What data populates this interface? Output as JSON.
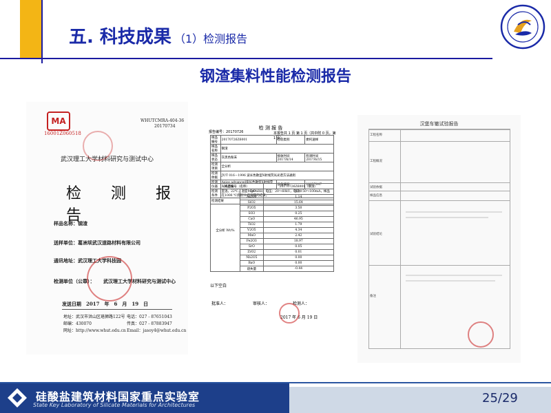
{
  "header": {
    "title": "五. 科技成果",
    "subtitle": "（1）检测报告",
    "colors": {
      "accent_yellow": "#f3b515",
      "primary_blue": "#1a2aa8",
      "line_blue": "#1a1aa0"
    }
  },
  "heading": "钢渣集料性能检测报告",
  "doc1": {
    "ma_mark": "MA",
    "ma_code": "16001Z060518",
    "ref_code": "WHUTCMRA-404-36",
    "ref_no": "20170734",
    "institution": "武汉理工大学材料研究与测试中心",
    "big_title": "检 测 报 告",
    "sample_label": "样品名称：钢渣",
    "client_label": "送样单位：葛洲坝武汉道路材料有限公司",
    "address_label": "通讯地址：武汉理工大学科技园",
    "test_unit_label": "检测单位（公章）：",
    "test_unit_value": "武汉理工大学材料研究与测试中心",
    "issue_date": "发送日期　2017　年　6　月　19　日",
    "contact_addr": "地址：武汉市洪山区珞狮路122号",
    "contact_post": "邮编：430070",
    "contact_web": "网址：http://www.whut.edu.cn",
    "contact_tel": "电话：027 - 87651043",
    "contact_fax": "传真：027 - 87883947",
    "contact_email": "Email：jasoy4@whut.edu.cn"
  },
  "doc2": {
    "title": "检 测 报 告",
    "meta_left": "报告编号：20170726",
    "meta_right": "本报告共 1 页 第 1 页（共中附 0 页，第 1 页）",
    "info_rows": [
      [
        "样品编号",
        "20170726Z6001",
        "检验类别",
        "委托送样"
      ],
      [
        "样品名称",
        "钢渣",
        "",
        ""
      ],
      [
        "样品状态",
        "灰黑色粉末",
        "接收时间 2017/6/14",
        "检测时间 2017/6/15"
      ],
      [
        "检测项目",
        "全分析",
        "",
        ""
      ],
      [
        "检测依据",
        "JY/T 016－1996 波长色散型X射线荧光光谱方法通则",
        "",
        ""
      ],
      [
        "检测仪器",
        "Axios advanced波长色散型X射线荧光光谱仪",
        "设备编号",
        "20057047"
      ],
      [
        "检测条件",
        "室温，22℃，湿度：54%RH，电压：20～60kV，电流：50～100mA，样品在1000 ℃烧损1h后测量的结果。",
        "",
        ""
      ],
      [
        "检测结果",
        "",
        "",
        ""
      ]
    ],
    "comp_header": [
      "样品编号（名称）",
      "20170726Z6001（钢渣）"
    ],
    "comp_group": "全分析 Wt/%",
    "composition": [
      [
        "MgO",
        "4.30"
      ],
      [
        "Al2O3",
        "1.14"
      ],
      [
        "SiO2",
        "15.64"
      ],
      [
        "P2O5",
        "3.50"
      ],
      [
        "SO3",
        "0.25"
      ],
      [
        "CaO",
        "46.95"
      ],
      [
        "TiO2",
        "1.79"
      ],
      [
        "V2O5",
        "4.34"
      ],
      [
        "MnO",
        "2.42"
      ],
      [
        "Fe2O3",
        "18.97"
      ],
      [
        "SrO",
        "0.05"
      ],
      [
        "ZrO2",
        "0.01"
      ],
      [
        "Nb2O5",
        "0.00"
      ],
      [
        "BaO",
        "0.00"
      ],
      [
        "烧失量",
        "-0.44"
      ]
    ],
    "blank_note": "以下空白",
    "sign_approver": "批准人：",
    "sign_reviewer": "审核人：",
    "sign_tester": "检测人：",
    "sign_date": "2017 年 6 月 19 日"
  },
  "doc3": {
    "title": "汉堡车辙试验报告",
    "sections": [
      "工程名称",
      "工程概况",
      "试验依据",
      "样品信息",
      "试验结论",
      "备注"
    ]
  },
  "footer": {
    "lab_cn": "硅酸盐建筑材料国家重点实验室",
    "lab_en": "State Key Laboratory of Silicate Materials for Architectures",
    "page": "25/29",
    "colors": {
      "brand_bar": "#1d3f8a",
      "footer_bg": "#cfd9e6"
    }
  },
  "logo": {
    "icon": "university-seal-icon"
  }
}
